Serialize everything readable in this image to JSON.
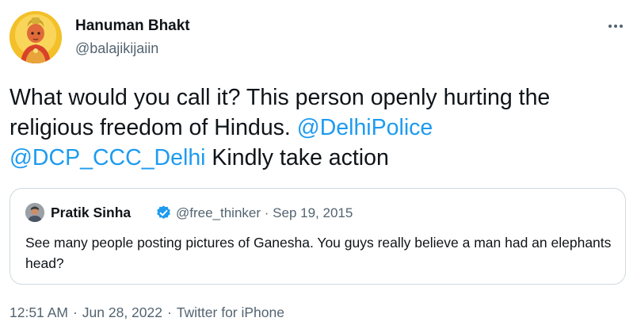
{
  "author": {
    "name": "Hanuman Bhakt",
    "handle": "@balajikijaiin"
  },
  "tweet": {
    "text_part1": "What would you call it? This person openly hurting the religious freedom of Hindus. ",
    "mention1": "@DelhiPolice",
    "mention2": "@DCP_CCC_Delhi",
    "text_part2": " Kindly take action"
  },
  "quoted_tweet": {
    "author_name": "Pratik Sinha",
    "author_handle": "@free_thinker",
    "separator": "·",
    "date": "Sep 19, 2015",
    "text": "See many people posting pictures of Ganesha. You guys really believe a man had an elephants head?"
  },
  "footer": {
    "time": "12:51 AM",
    "date": "Jun 28, 2022",
    "source": "Twitter for iPhone",
    "separator": "·"
  },
  "icons": {
    "more": "more-horizontal-icon",
    "verified": "verified-badge-icon"
  },
  "colors": {
    "link": "#1d9bf0",
    "secondary_text": "#536471",
    "primary_text": "#0f1419",
    "border": "#cfd9de"
  }
}
